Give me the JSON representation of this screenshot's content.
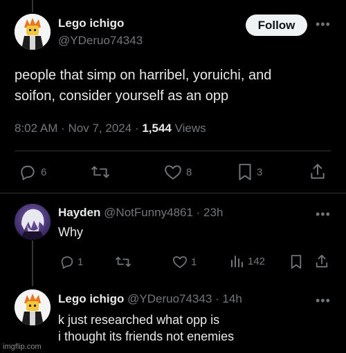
{
  "main_tweet": {
    "author_name": "Lego ichigo",
    "author_handle": "@YDeruo74343",
    "follow_label": "Follow",
    "text_line1": "people that simp on harribel, yoruichi, and",
    "text_line2": "soifon, consider yourself as an opp",
    "time": "8:02 AM",
    "date": "Nov 7, 2024",
    "sep": "·",
    "views_count": "1,544",
    "views_label": "Views",
    "replies": "6",
    "likes": "8",
    "bookmarks": "3"
  },
  "reply1": {
    "author_name": "Hayden",
    "author_handle": "@NotFunny4861",
    "meta": "· 23h",
    "text": "Why",
    "replies": "1",
    "likes": "1",
    "views": "142"
  },
  "reply2": {
    "author_name": "Lego ichigo",
    "author_handle": "@YDeruo74343",
    "meta": "· 14h",
    "text_line1": "k just researched what opp is",
    "text_line2": "i thought its friends not enemies"
  },
  "watermark": "imgflip.com",
  "colors": {
    "background": "#000000",
    "text_primary": "#e7e9ea",
    "text_secondary": "#71767b",
    "divider": "#2f3336",
    "follow_bg": "#eff3f4"
  },
  "icons": [
    "reply-icon",
    "retweet-icon",
    "like-icon",
    "bookmark-icon",
    "share-icon",
    "views-icon",
    "more-icon"
  ]
}
